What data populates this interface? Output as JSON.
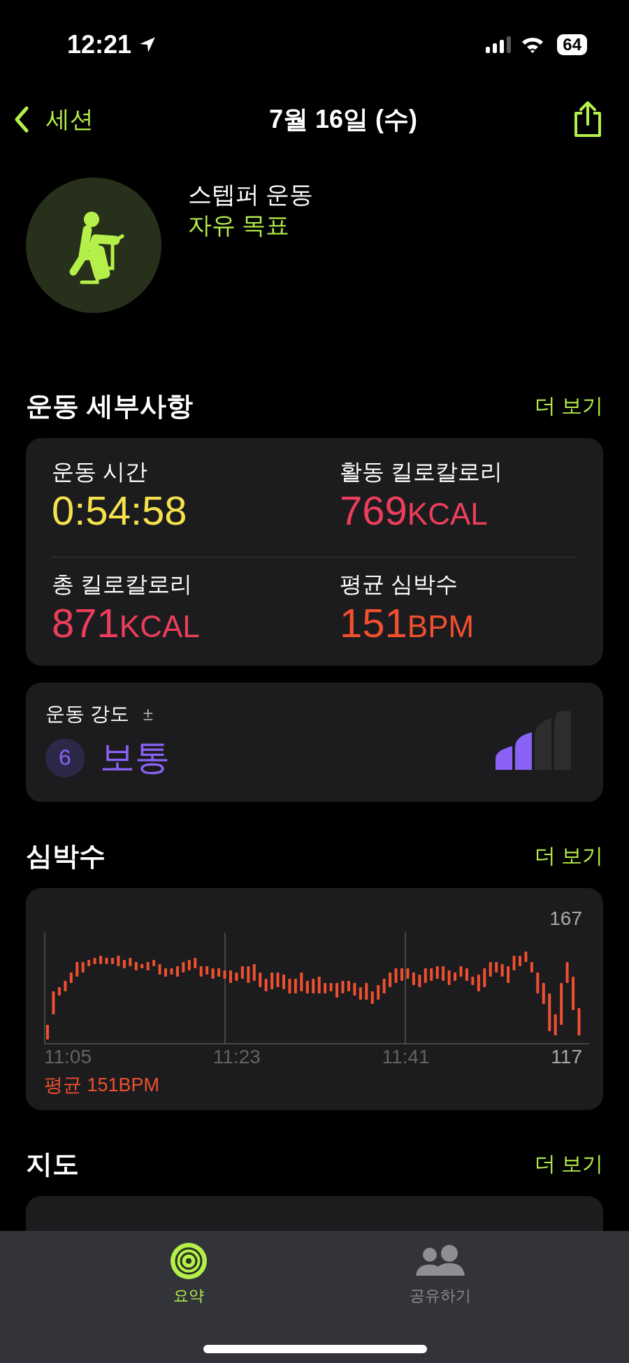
{
  "status_bar": {
    "time": "12:21",
    "battery": "64"
  },
  "nav": {
    "back": "세션",
    "title": "7월 16일 (수)"
  },
  "workout": {
    "name": "스텝퍼 운동",
    "goal": "자유 목표"
  },
  "details": {
    "heading": "운동 세부사항",
    "more": "더 보기",
    "metrics": [
      {
        "label": "운동 시간",
        "value": "0:54:58",
        "color": "#f5e14b"
      },
      {
        "label": "활동 킬로칼로리",
        "value": "769",
        "unit": "KCAL",
        "color": "#ec3e5a"
      },
      {
        "label": "총 킬로칼로리",
        "value": "871",
        "unit": "KCAL",
        "color": "#ec3e5a"
      },
      {
        "label": "평균 심박수",
        "value": "151",
        "unit": "BPM",
        "color": "#f0502f"
      }
    ]
  },
  "effort": {
    "label": "운동 강도",
    "adjust": "±",
    "score": "6",
    "rating": "보통",
    "level": 0.5
  },
  "heart_rate": {
    "heading": "심박수",
    "more": "더 보기",
    "max": "167",
    "min": "117",
    "times": [
      "11:05",
      "11:23",
      "11:41"
    ],
    "average": "평균 151BPM"
  },
  "map": {
    "heading": "지도",
    "more": "더 보기"
  },
  "tabs": [
    {
      "label": "요약",
      "selected": true
    },
    {
      "label": "공유하기",
      "selected": false
    }
  ]
}
